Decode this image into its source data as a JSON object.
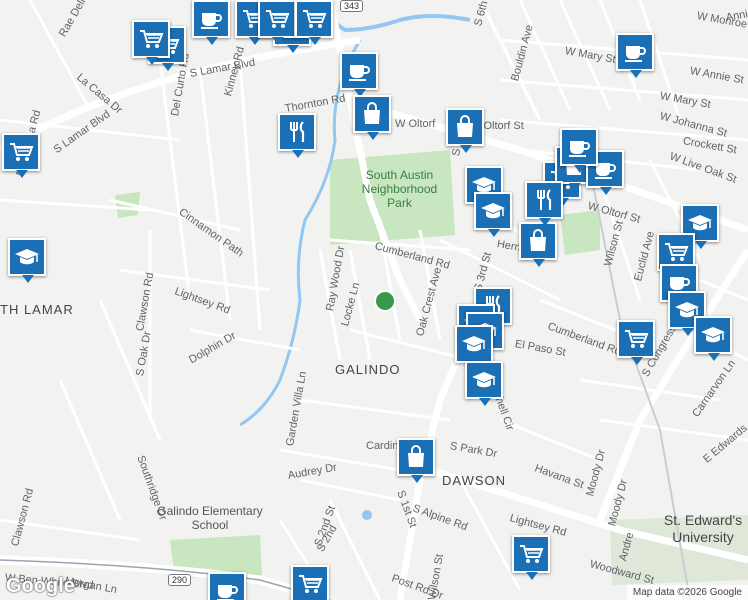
{
  "map": {
    "colors": {
      "background": "#f2f3f1",
      "road": "#ffffff",
      "major_road": "#ffffff",
      "water": "#93c6f0",
      "park": "#c8e6c0",
      "pin": "#1a6fb5"
    },
    "street_labels": [
      {
        "text": "Rae Dell"
      },
      {
        "text": "La Casa Dr"
      },
      {
        "text": "S Lamar Blvd"
      },
      {
        "text": "S Lamar Blvd"
      },
      {
        "text": "Del Curto Rd"
      },
      {
        "text": "Kinney Rd"
      },
      {
        "text": "Thornton Rd"
      },
      {
        "text": "Menchaca Rd"
      },
      {
        "text": "Cinnamon Path"
      },
      {
        "text": "Lightsey Rd"
      },
      {
        "text": "Clawson Rd"
      },
      {
        "text": "S Oak Dr"
      },
      {
        "text": "Dolphin Dr"
      },
      {
        "text": "Southridge Dr"
      },
      {
        "text": "Clawson Rd"
      },
      {
        "text": "Morgan Ln"
      },
      {
        "text": "W Ben White Blvd"
      },
      {
        "text": "Garden Villa Ln"
      },
      {
        "text": "Audrey Dr"
      },
      {
        "text": "S 2nd St"
      },
      {
        "text": "Ray Wood Dr"
      },
      {
        "text": "Locke Ln"
      },
      {
        "text": "Cumberland Rd"
      },
      {
        "text": "Oak Crest Ave"
      },
      {
        "text": "S 3rd St"
      },
      {
        "text": "S 5th St"
      },
      {
        "text": "Herndon Ln"
      },
      {
        "text": "W Oltorf St"
      },
      {
        "text": "W Oltorf St"
      },
      {
        "text": "Bouldin Ave"
      },
      {
        "text": "W Mary St"
      },
      {
        "text": "W Mary St"
      },
      {
        "text": "W Annie St"
      },
      {
        "text": "W Johanna St"
      },
      {
        "text": "W Live Oak St"
      },
      {
        "text": "Crockett St"
      },
      {
        "text": "W Monroe St"
      },
      {
        "text": "Annie St"
      },
      {
        "text": "S 6th St"
      },
      {
        "text": "Cumberland Rd"
      },
      {
        "text": "El Paso St"
      },
      {
        "text": "Wilson St"
      },
      {
        "text": "Euclid Ave"
      },
      {
        "text": "S Congress"
      },
      {
        "text": "Carnarvon Ln"
      },
      {
        "text": "E Edwards"
      },
      {
        "text": "Havana St"
      },
      {
        "text": "S Park Dr"
      },
      {
        "text": "Cardinal"
      },
      {
        "text": "Moody Dr"
      },
      {
        "text": "Moody Dr"
      },
      {
        "text": "Lightsey Rd"
      },
      {
        "text": "Woodward St"
      },
      {
        "text": "S Alpine Rd"
      },
      {
        "text": "Post Rd Dr"
      },
      {
        "text": "Krebs Ln"
      },
      {
        "text": "Wilson St"
      },
      {
        "text": "Andre"
      },
      {
        "text": "S 1st St"
      },
      {
        "text": "Shell Cir"
      },
      {
        "text": "W Oltorf"
      },
      {
        "text": "S 2nd"
      }
    ],
    "area_labels": [
      {
        "text": "GALINDO"
      },
      {
        "text": "DAWSON"
      },
      {
        "text": "TH LAMAR"
      }
    ],
    "park_label": "South Austin Neighborhood Park",
    "school_label": "Galindo Elementary School",
    "university_label": "St. Edward's University",
    "shields": [
      {
        "text": "343"
      },
      {
        "text": "290"
      }
    ],
    "pins": [
      {
        "icon": "grocery-icon"
      },
      {
        "icon": "grocery-icon"
      },
      {
        "icon": "coffee-icon"
      },
      {
        "icon": "grocery-icon"
      },
      {
        "icon": "shopping-bag-icon"
      },
      {
        "icon": "grocery-icon"
      },
      {
        "icon": "grocery-icon"
      },
      {
        "icon": "restaurant-icon"
      },
      {
        "icon": "coffee-icon"
      },
      {
        "icon": "shopping-bag-icon"
      },
      {
        "icon": "shopping-bag-icon"
      },
      {
        "icon": "coffee-icon"
      },
      {
        "icon": "school-icon"
      },
      {
        "icon": "grocery-icon"
      },
      {
        "icon": "shopping-bag-icon"
      },
      {
        "icon": "coffee-icon"
      },
      {
        "icon": "school-icon"
      },
      {
        "icon": "school-icon"
      },
      {
        "icon": "restaurant-icon"
      },
      {
        "icon": "shopping-bag-icon"
      },
      {
        "icon": "school-icon"
      },
      {
        "icon": "grocery-icon"
      },
      {
        "icon": "coffee-icon"
      },
      {
        "icon": "school-icon"
      },
      {
        "icon": "school-icon"
      },
      {
        "icon": "grocery-icon"
      },
      {
        "icon": "restaurant-icon"
      },
      {
        "icon": "school-icon"
      },
      {
        "icon": "school-icon"
      },
      {
        "icon": "school-icon"
      },
      {
        "icon": "shopping-bag-icon"
      },
      {
        "icon": "school-icon"
      },
      {
        "icon": "grocery-icon"
      },
      {
        "icon": "coffee-icon"
      },
      {
        "icon": "grocery-icon"
      },
      {
        "icon": "coffee-icon"
      },
      {
        "icon": "grocery-icon"
      }
    ],
    "logo": "Google",
    "attribution": "Map data ©2026 Google"
  }
}
